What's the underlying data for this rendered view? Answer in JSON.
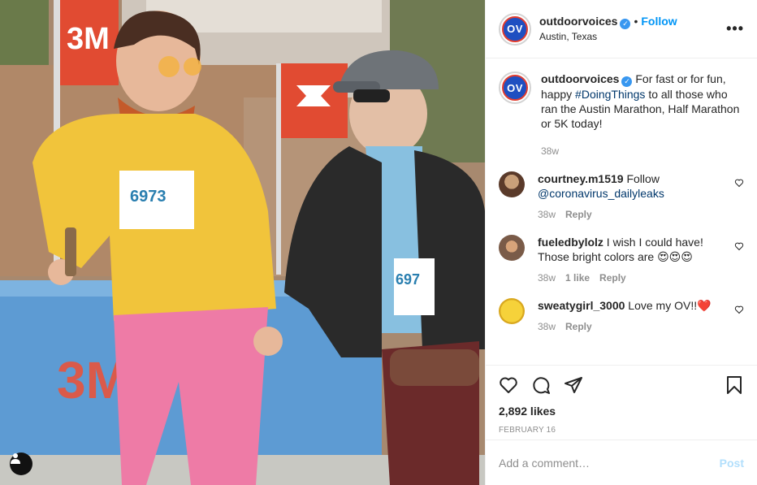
{
  "post": {
    "username": "outdoorvoices",
    "avatar_text": "OV",
    "follow_label": "Follow",
    "separator": "•",
    "location": "Austin, Texas",
    "more_label": "•••",
    "bib_number": "6973",
    "bib_number_partial": "697",
    "sponsor_3m": "3M",
    "sponsor_3m_small": "3M"
  },
  "caption": {
    "username": "outdoorvoices",
    "text_before": "For fast or for fun, happy ",
    "hashtag": "#DoingThings",
    "text_after": " to all those who ran the Austin Marathon, Half Marathon or 5K today!",
    "time": "38w"
  },
  "comments": [
    {
      "username": "courtney.m1519",
      "text": "Follow ",
      "mention": "@coronavirus_dailyleaks",
      "time": "38w",
      "likes": "",
      "reply": "Reply"
    },
    {
      "username": "fueledbylolz",
      "text": "I wish I could have! Those bright colors are 😍😍😍",
      "time": "38w",
      "likes": "1 like",
      "reply": "Reply"
    },
    {
      "username": "sweatygirl_3000",
      "text": "Love my OV!!❤️",
      "time": "38w",
      "likes": "",
      "reply": "Reply"
    }
  ],
  "footer": {
    "likes": "2,892 likes",
    "date": "FEBRUARY 16",
    "comment_placeholder": "Add a comment…",
    "post_label": "Post"
  },
  "colors": {
    "accent": "#0095f6",
    "verified": "#3897f0",
    "post_disabled": "#b2dffc"
  },
  "icons": [
    "verified-icon",
    "more-options-icon",
    "heart-icon",
    "comment-icon",
    "share-icon",
    "bookmark-icon",
    "user-tag-icon",
    "comment-like-icon"
  ]
}
